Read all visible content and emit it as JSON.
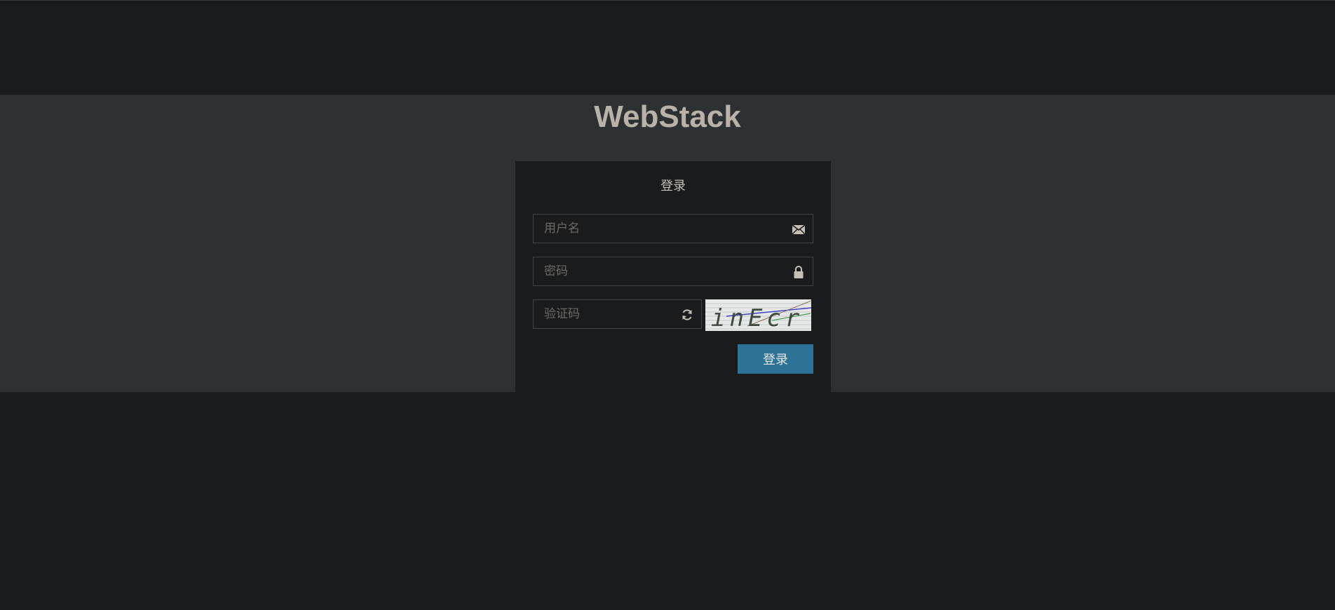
{
  "site": {
    "title": "WebStack"
  },
  "login": {
    "heading": "登录",
    "username_placeholder": "用户名",
    "password_placeholder": "密码",
    "captcha_placeholder": "验证码",
    "captcha_text": "inEcr",
    "submit_label": "登录"
  },
  "icons": {
    "username": "envelope-icon",
    "password": "lock-icon",
    "captcha": "refresh-icon"
  },
  "colors": {
    "page_bg": "#1a1b1d",
    "band_bg": "#2d3134",
    "title": "#b9b2a8",
    "button_bg": "#2d7397"
  }
}
